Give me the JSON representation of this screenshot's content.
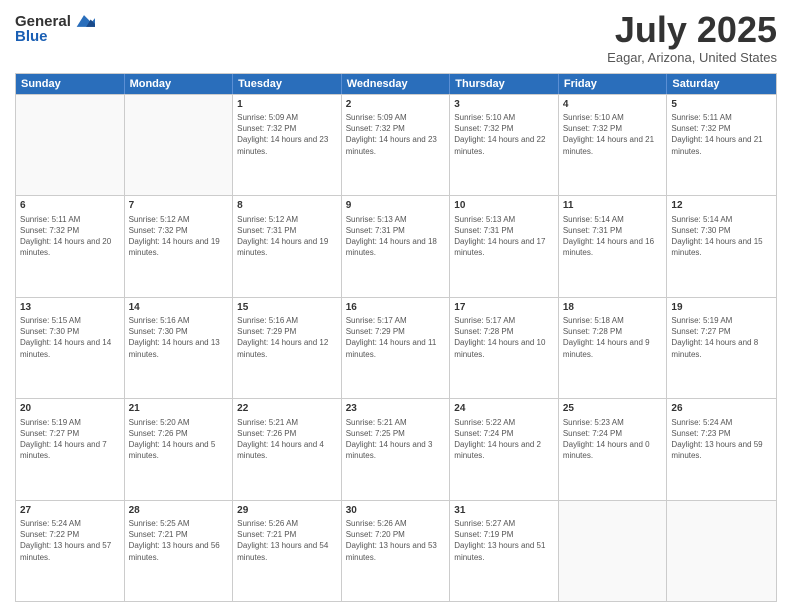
{
  "logo": {
    "general": "General",
    "blue": "Blue"
  },
  "title": "July 2025",
  "location": "Eagar, Arizona, United States",
  "days_of_week": [
    "Sunday",
    "Monday",
    "Tuesday",
    "Wednesday",
    "Thursday",
    "Friday",
    "Saturday"
  ],
  "weeks": [
    [
      {
        "day": "",
        "info": ""
      },
      {
        "day": "",
        "info": ""
      },
      {
        "day": "1",
        "info": "Sunrise: 5:09 AM\nSunset: 7:32 PM\nDaylight: 14 hours and 23 minutes."
      },
      {
        "day": "2",
        "info": "Sunrise: 5:09 AM\nSunset: 7:32 PM\nDaylight: 14 hours and 23 minutes."
      },
      {
        "day": "3",
        "info": "Sunrise: 5:10 AM\nSunset: 7:32 PM\nDaylight: 14 hours and 22 minutes."
      },
      {
        "day": "4",
        "info": "Sunrise: 5:10 AM\nSunset: 7:32 PM\nDaylight: 14 hours and 21 minutes."
      },
      {
        "day": "5",
        "info": "Sunrise: 5:11 AM\nSunset: 7:32 PM\nDaylight: 14 hours and 21 minutes."
      }
    ],
    [
      {
        "day": "6",
        "info": "Sunrise: 5:11 AM\nSunset: 7:32 PM\nDaylight: 14 hours and 20 minutes."
      },
      {
        "day": "7",
        "info": "Sunrise: 5:12 AM\nSunset: 7:32 PM\nDaylight: 14 hours and 19 minutes."
      },
      {
        "day": "8",
        "info": "Sunrise: 5:12 AM\nSunset: 7:31 PM\nDaylight: 14 hours and 19 minutes."
      },
      {
        "day": "9",
        "info": "Sunrise: 5:13 AM\nSunset: 7:31 PM\nDaylight: 14 hours and 18 minutes."
      },
      {
        "day": "10",
        "info": "Sunrise: 5:13 AM\nSunset: 7:31 PM\nDaylight: 14 hours and 17 minutes."
      },
      {
        "day": "11",
        "info": "Sunrise: 5:14 AM\nSunset: 7:31 PM\nDaylight: 14 hours and 16 minutes."
      },
      {
        "day": "12",
        "info": "Sunrise: 5:14 AM\nSunset: 7:30 PM\nDaylight: 14 hours and 15 minutes."
      }
    ],
    [
      {
        "day": "13",
        "info": "Sunrise: 5:15 AM\nSunset: 7:30 PM\nDaylight: 14 hours and 14 minutes."
      },
      {
        "day": "14",
        "info": "Sunrise: 5:16 AM\nSunset: 7:30 PM\nDaylight: 14 hours and 13 minutes."
      },
      {
        "day": "15",
        "info": "Sunrise: 5:16 AM\nSunset: 7:29 PM\nDaylight: 14 hours and 12 minutes."
      },
      {
        "day": "16",
        "info": "Sunrise: 5:17 AM\nSunset: 7:29 PM\nDaylight: 14 hours and 11 minutes."
      },
      {
        "day": "17",
        "info": "Sunrise: 5:17 AM\nSunset: 7:28 PM\nDaylight: 14 hours and 10 minutes."
      },
      {
        "day": "18",
        "info": "Sunrise: 5:18 AM\nSunset: 7:28 PM\nDaylight: 14 hours and 9 minutes."
      },
      {
        "day": "19",
        "info": "Sunrise: 5:19 AM\nSunset: 7:27 PM\nDaylight: 14 hours and 8 minutes."
      }
    ],
    [
      {
        "day": "20",
        "info": "Sunrise: 5:19 AM\nSunset: 7:27 PM\nDaylight: 14 hours and 7 minutes."
      },
      {
        "day": "21",
        "info": "Sunrise: 5:20 AM\nSunset: 7:26 PM\nDaylight: 14 hours and 5 minutes."
      },
      {
        "day": "22",
        "info": "Sunrise: 5:21 AM\nSunset: 7:26 PM\nDaylight: 14 hours and 4 minutes."
      },
      {
        "day": "23",
        "info": "Sunrise: 5:21 AM\nSunset: 7:25 PM\nDaylight: 14 hours and 3 minutes."
      },
      {
        "day": "24",
        "info": "Sunrise: 5:22 AM\nSunset: 7:24 PM\nDaylight: 14 hours and 2 minutes."
      },
      {
        "day": "25",
        "info": "Sunrise: 5:23 AM\nSunset: 7:24 PM\nDaylight: 14 hours and 0 minutes."
      },
      {
        "day": "26",
        "info": "Sunrise: 5:24 AM\nSunset: 7:23 PM\nDaylight: 13 hours and 59 minutes."
      }
    ],
    [
      {
        "day": "27",
        "info": "Sunrise: 5:24 AM\nSunset: 7:22 PM\nDaylight: 13 hours and 57 minutes."
      },
      {
        "day": "28",
        "info": "Sunrise: 5:25 AM\nSunset: 7:21 PM\nDaylight: 13 hours and 56 minutes."
      },
      {
        "day": "29",
        "info": "Sunrise: 5:26 AM\nSunset: 7:21 PM\nDaylight: 13 hours and 54 minutes."
      },
      {
        "day": "30",
        "info": "Sunrise: 5:26 AM\nSunset: 7:20 PM\nDaylight: 13 hours and 53 minutes."
      },
      {
        "day": "31",
        "info": "Sunrise: 5:27 AM\nSunset: 7:19 PM\nDaylight: 13 hours and 51 minutes."
      },
      {
        "day": "",
        "info": ""
      },
      {
        "day": "",
        "info": ""
      }
    ]
  ]
}
